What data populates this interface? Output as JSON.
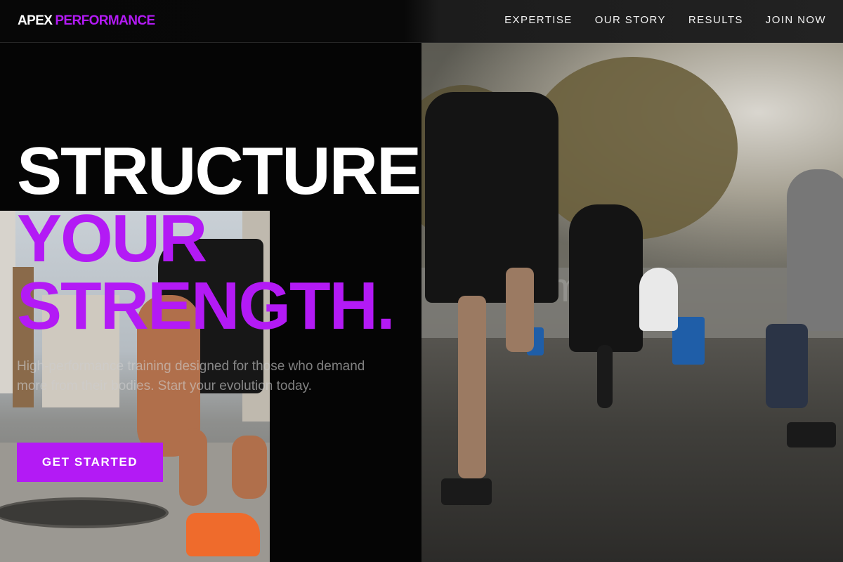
{
  "brand": {
    "name_part1": "APEX",
    "name_part2": "PERFORMANCE",
    "accent_color": "#b31af5"
  },
  "nav": {
    "items": [
      {
        "label": "EXPERTISE"
      },
      {
        "label": "OUR STORY"
      },
      {
        "label": "RESULTS"
      },
      {
        "label": "JOIN NOW"
      }
    ]
  },
  "hero": {
    "line1": "STRUCTURE",
    "line2": "YOUR",
    "line3": "STRENGTH.",
    "subtitle": "High-performance training designed for those who demand more from their bodies. Start your evolution today.",
    "cta_label": "GET STARTED"
  },
  "images": {
    "left": {
      "icon": "athlete-tying-shoe-image"
    },
    "right": {
      "icon": "group-running-drills-image",
      "watermark": "template"
    }
  }
}
